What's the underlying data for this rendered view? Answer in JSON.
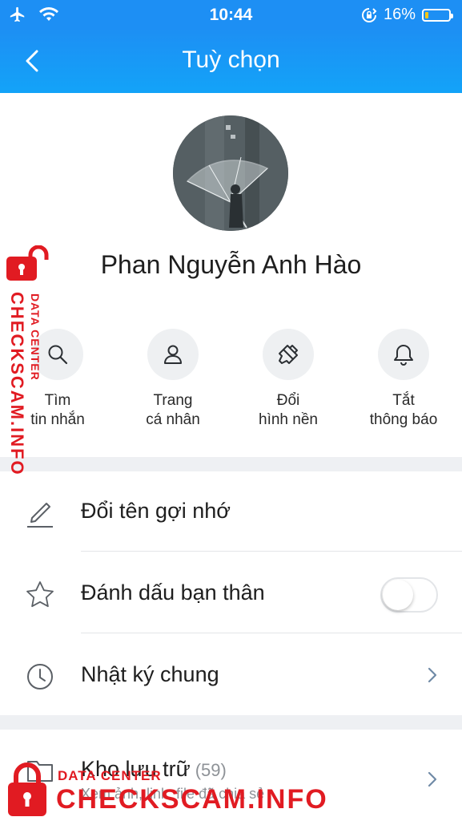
{
  "status_bar": {
    "time": "10:44",
    "battery_percent": "16%",
    "battery_level": 0.16,
    "icons": [
      "airplane-icon",
      "wifi-icon",
      "rotation-lock-icon",
      "battery-icon"
    ]
  },
  "nav": {
    "title": "Tuỳ chọn",
    "back_icon": "chevron-left-icon"
  },
  "profile": {
    "name": "Phan Nguyễn Anh Hào"
  },
  "actions": [
    {
      "line1": "Tìm",
      "line2": "tin nhắn",
      "icon": "search-icon"
    },
    {
      "line1": "Trang",
      "line2": "cá nhân",
      "icon": "person-icon"
    },
    {
      "line1": "Đổi",
      "line2": "hình nền",
      "icon": "paint-brush-icon"
    },
    {
      "line1": "Tắt",
      "line2": "thông báo",
      "icon": "bell-icon"
    }
  ],
  "settings": {
    "rename": {
      "label": "Đổi tên gợi nhớ",
      "icon": "pencil-icon"
    },
    "best_friend": {
      "label": "Đánh dấu bạn thân",
      "icon": "star-icon",
      "toggle_on": false
    },
    "shared_diary": {
      "label": "Nhật ký chung",
      "icon": "clock-icon"
    },
    "storage": {
      "label": "Kho lưu trữ",
      "count": "(59)",
      "subtitle": "Xem ảnh, link, file đã chia sẻ",
      "icon": "folder-icon"
    }
  },
  "watermark": {
    "line1": "DATA CENTER",
    "line2": "CHECKSCAM.INFO"
  },
  "colors": {
    "header_blue": "#1d8ff4",
    "watermark_red": "#e11b22",
    "separator": "#eef0f3"
  }
}
